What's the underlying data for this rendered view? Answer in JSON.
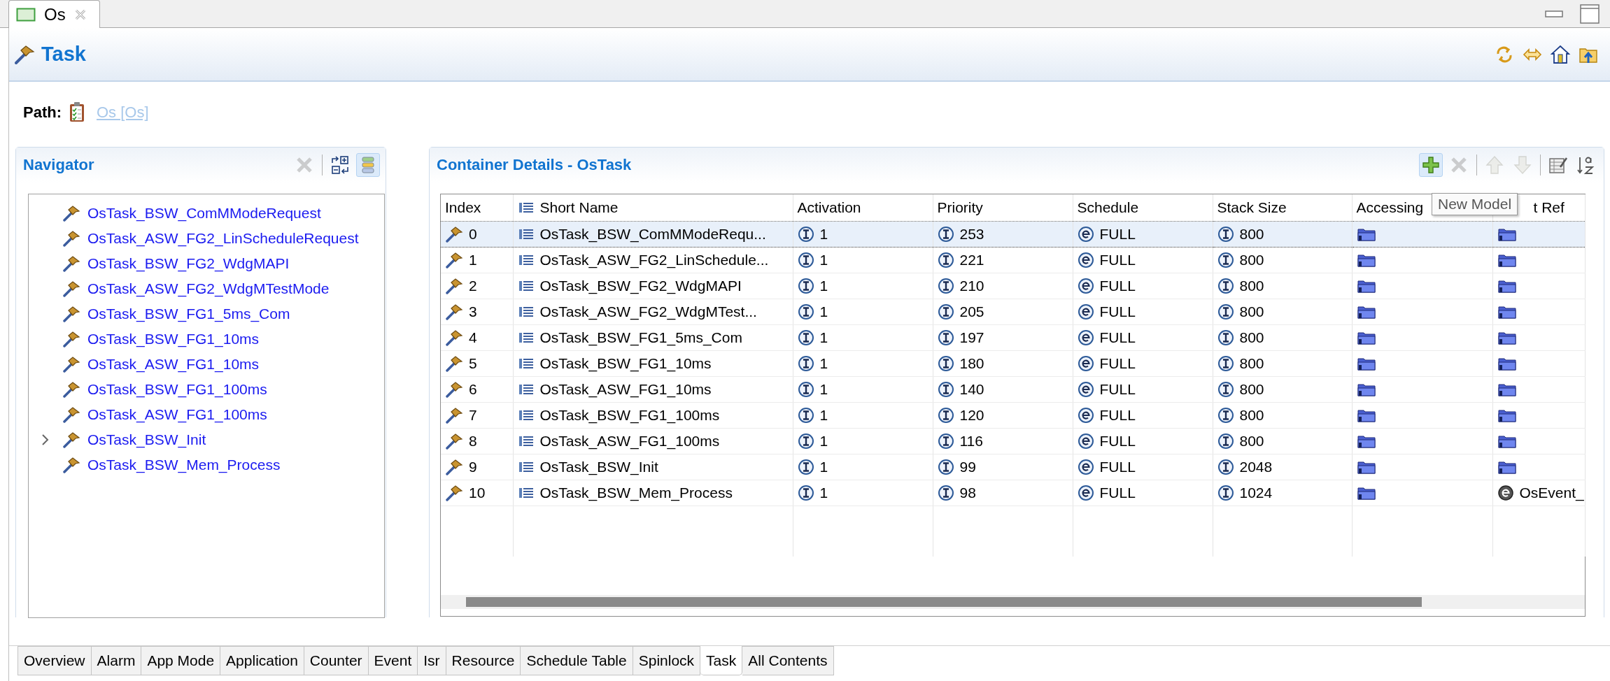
{
  "editor_tab": {
    "label": "Os"
  },
  "header": {
    "title": "Task",
    "toolbar": [
      {
        "kind": "sync"
      },
      {
        "kind": "swap"
      },
      {
        "kind": "home"
      },
      {
        "kind": "folder-up"
      }
    ]
  },
  "path": {
    "label": "Path:",
    "link": "Os [Os]"
  },
  "navigator": {
    "title": "Navigator",
    "toolbar": [
      {
        "kind": "clear",
        "disabled": true,
        "highlighted": false
      },
      {
        "kind": "separator"
      },
      {
        "kind": "collapse",
        "disabled": false,
        "highlighted": false
      },
      {
        "kind": "layout",
        "disabled": false,
        "highlighted": true
      }
    ],
    "items": [
      {
        "label": "OsTask_BSW_ComMModeRequest",
        "expandable": false
      },
      {
        "label": "OsTask_ASW_FG2_LinScheduleRequest",
        "expandable": false
      },
      {
        "label": "OsTask_BSW_FG2_WdgMAPI",
        "expandable": false
      },
      {
        "label": "OsTask_ASW_FG2_WdgMTestMode",
        "expandable": false
      },
      {
        "label": "OsTask_BSW_FG1_5ms_Com",
        "expandable": false
      },
      {
        "label": "OsTask_BSW_FG1_10ms",
        "expandable": false
      },
      {
        "label": "OsTask_ASW_FG1_10ms",
        "expandable": false
      },
      {
        "label": "OsTask_BSW_FG1_100ms",
        "expandable": false
      },
      {
        "label": "OsTask_ASW_FG1_100ms",
        "expandable": false
      },
      {
        "label": "OsTask_BSW_Init",
        "expandable": true
      },
      {
        "label": "OsTask_BSW_Mem_Process",
        "expandable": false
      }
    ]
  },
  "details": {
    "title": "Container Details - OsTask",
    "toolbar": [
      {
        "kind": "add",
        "disabled": false,
        "highlighted": true
      },
      {
        "kind": "delete",
        "disabled": true,
        "highlighted": false
      },
      {
        "kind": "separator"
      },
      {
        "kind": "up",
        "disabled": true,
        "highlighted": false
      },
      {
        "kind": "down",
        "disabled": true,
        "highlighted": false
      },
      {
        "kind": "separator"
      },
      {
        "kind": "edit-table",
        "disabled": false,
        "highlighted": false
      },
      {
        "kind": "sort",
        "disabled": false,
        "highlighted": false
      }
    ],
    "columns": [
      {
        "label": "Index",
        "kind": "plain"
      },
      {
        "label": "Short Name",
        "kind": "name"
      },
      {
        "label": "Activation",
        "kind": "plain"
      },
      {
        "label": "Priority",
        "kind": "plain"
      },
      {
        "label": "Schedule",
        "kind": "plain"
      },
      {
        "label": "Stack Size",
        "kind": "plain"
      },
      {
        "label": "Accessing",
        "kind": "plain"
      },
      {
        "label": "t Ref",
        "kind": "plain"
      }
    ],
    "rows": [
      {
        "selected": true,
        "cells": [
          {
            "kind": "task",
            "text": "0"
          },
          {
            "kind": "name",
            "text": "OsTask_BSW_ComMModeRequ..."
          },
          {
            "kind": "int",
            "text": "1"
          },
          {
            "kind": "int",
            "text": "253"
          },
          {
            "kind": "enum",
            "text": "FULL"
          },
          {
            "kind": "int",
            "text": "800"
          },
          {
            "kind": "ref"
          },
          {
            "kind": "ref"
          }
        ]
      },
      {
        "selected": false,
        "cells": [
          {
            "kind": "task",
            "text": "1"
          },
          {
            "kind": "name",
            "text": "OsTask_ASW_FG2_LinSchedule..."
          },
          {
            "kind": "int",
            "text": "1"
          },
          {
            "kind": "int",
            "text": "221"
          },
          {
            "kind": "enum",
            "text": "FULL"
          },
          {
            "kind": "int",
            "text": "800"
          },
          {
            "kind": "ref"
          },
          {
            "kind": "ref"
          }
        ]
      },
      {
        "selected": false,
        "cells": [
          {
            "kind": "task",
            "text": "2"
          },
          {
            "kind": "name",
            "text": "OsTask_BSW_FG2_WdgMAPI"
          },
          {
            "kind": "int",
            "text": "1"
          },
          {
            "kind": "int",
            "text": "210"
          },
          {
            "kind": "enum",
            "text": "FULL"
          },
          {
            "kind": "int",
            "text": "800"
          },
          {
            "kind": "ref"
          },
          {
            "kind": "ref"
          }
        ]
      },
      {
        "selected": false,
        "cells": [
          {
            "kind": "task",
            "text": "3"
          },
          {
            "kind": "name",
            "text": "OsTask_ASW_FG2_WdgMTest..."
          },
          {
            "kind": "int",
            "text": "1"
          },
          {
            "kind": "int",
            "text": "205"
          },
          {
            "kind": "enum",
            "text": "FULL"
          },
          {
            "kind": "int",
            "text": "800"
          },
          {
            "kind": "ref"
          },
          {
            "kind": "ref"
          }
        ]
      },
      {
        "selected": false,
        "cells": [
          {
            "kind": "task",
            "text": "4"
          },
          {
            "kind": "name",
            "text": "OsTask_BSW_FG1_5ms_Com"
          },
          {
            "kind": "int",
            "text": "1"
          },
          {
            "kind": "int",
            "text": "197"
          },
          {
            "kind": "enum",
            "text": "FULL"
          },
          {
            "kind": "int",
            "text": "800"
          },
          {
            "kind": "ref"
          },
          {
            "kind": "ref"
          }
        ]
      },
      {
        "selected": false,
        "cells": [
          {
            "kind": "task",
            "text": "5"
          },
          {
            "kind": "name",
            "text": "OsTask_BSW_FG1_10ms"
          },
          {
            "kind": "int",
            "text": "1"
          },
          {
            "kind": "int",
            "text": "180"
          },
          {
            "kind": "enum",
            "text": "FULL"
          },
          {
            "kind": "int",
            "text": "800"
          },
          {
            "kind": "ref"
          },
          {
            "kind": "ref"
          }
        ]
      },
      {
        "selected": false,
        "cells": [
          {
            "kind": "task",
            "text": "6"
          },
          {
            "kind": "name",
            "text": "OsTask_ASW_FG1_10ms"
          },
          {
            "kind": "int",
            "text": "1"
          },
          {
            "kind": "int",
            "text": "140"
          },
          {
            "kind": "enum",
            "text": "FULL"
          },
          {
            "kind": "int",
            "text": "800"
          },
          {
            "kind": "ref"
          },
          {
            "kind": "ref"
          }
        ]
      },
      {
        "selected": false,
        "cells": [
          {
            "kind": "task",
            "text": "7"
          },
          {
            "kind": "name",
            "text": "OsTask_BSW_FG1_100ms"
          },
          {
            "kind": "int",
            "text": "1"
          },
          {
            "kind": "int",
            "text": "120"
          },
          {
            "kind": "enum",
            "text": "FULL"
          },
          {
            "kind": "int",
            "text": "800"
          },
          {
            "kind": "ref"
          },
          {
            "kind": "ref"
          }
        ]
      },
      {
        "selected": false,
        "cells": [
          {
            "kind": "task",
            "text": "8"
          },
          {
            "kind": "name",
            "text": "OsTask_ASW_FG1_100ms"
          },
          {
            "kind": "int",
            "text": "1"
          },
          {
            "kind": "int",
            "text": "116"
          },
          {
            "kind": "enum",
            "text": "FULL"
          },
          {
            "kind": "int",
            "text": "800"
          },
          {
            "kind": "ref"
          },
          {
            "kind": "ref"
          }
        ]
      },
      {
        "selected": false,
        "cells": [
          {
            "kind": "task",
            "text": "9"
          },
          {
            "kind": "name",
            "text": "OsTask_BSW_Init"
          },
          {
            "kind": "int",
            "text": "1"
          },
          {
            "kind": "int",
            "text": "99"
          },
          {
            "kind": "enum",
            "text": "FULL"
          },
          {
            "kind": "int",
            "text": "2048"
          },
          {
            "kind": "ref"
          },
          {
            "kind": "ref"
          }
        ]
      },
      {
        "selected": false,
        "cells": [
          {
            "kind": "task",
            "text": "10"
          },
          {
            "kind": "name",
            "text": "OsTask_BSW_Mem_Process"
          },
          {
            "kind": "int",
            "text": "1"
          },
          {
            "kind": "int",
            "text": "98"
          },
          {
            "kind": "enum",
            "text": "FULL"
          },
          {
            "kind": "int",
            "text": "1024"
          },
          {
            "kind": "ref"
          },
          {
            "kind": "event",
            "text": "OsEvent_"
          }
        ]
      }
    ]
  },
  "tooltip": {
    "text": "New Model"
  },
  "bottom_tabs": [
    {
      "label": "Overview",
      "selected": false
    },
    {
      "label": "Alarm",
      "selected": false
    },
    {
      "label": "App Mode",
      "selected": false
    },
    {
      "label": "Application",
      "selected": false
    },
    {
      "label": "Counter",
      "selected": false
    },
    {
      "label": "Event",
      "selected": false
    },
    {
      "label": "Isr",
      "selected": false
    },
    {
      "label": "Resource",
      "selected": false
    },
    {
      "label": "Schedule Table",
      "selected": false
    },
    {
      "label": "Spinlock",
      "selected": false
    },
    {
      "label": "Task",
      "selected": true
    },
    {
      "label": "All Contents",
      "selected": false
    }
  ]
}
